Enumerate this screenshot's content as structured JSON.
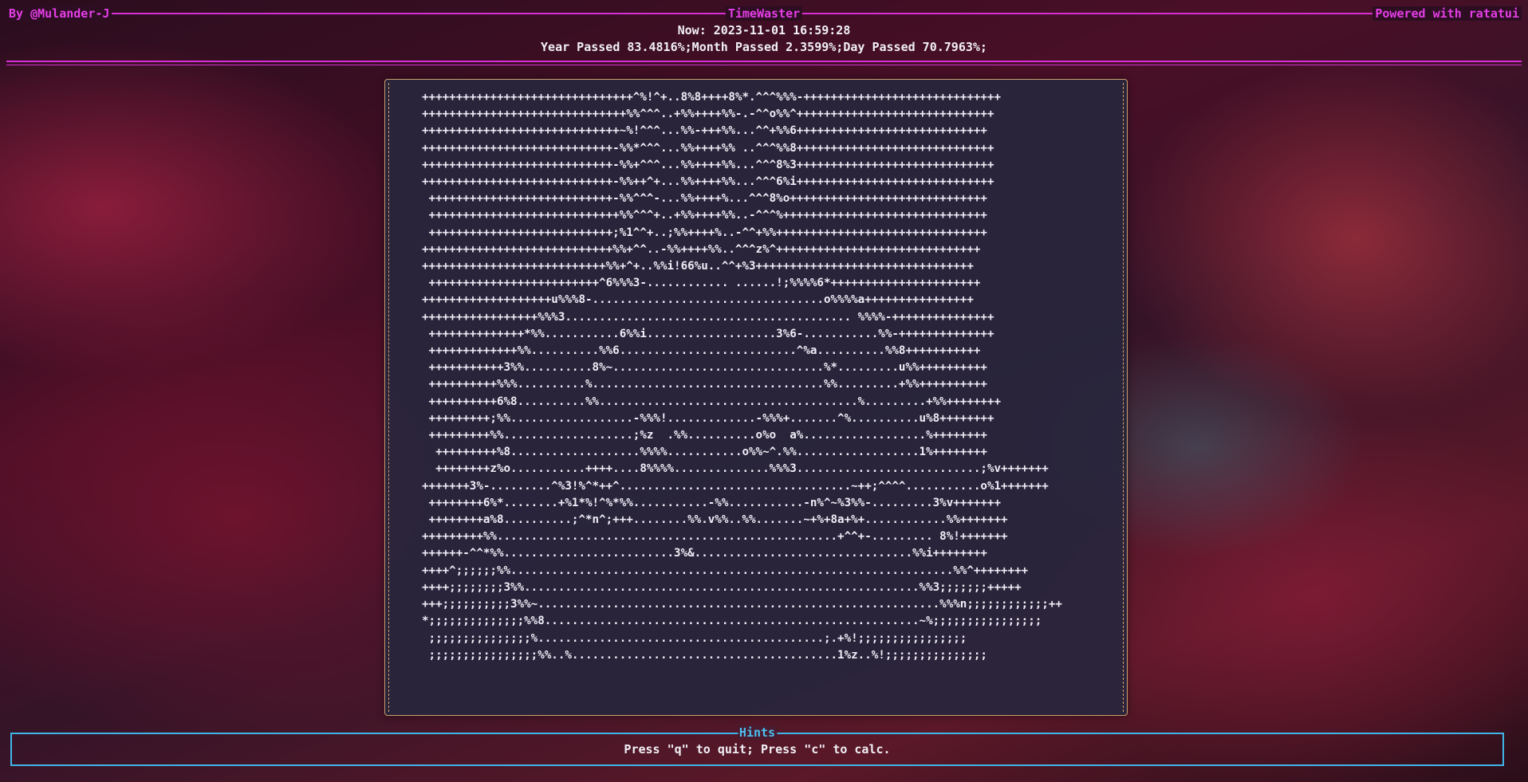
{
  "header": {
    "author": "By @Mulander-J",
    "title": "TimeWaster",
    "powered_by": "Powered with ratatui",
    "now_text": "Now: 2023-11-01 16:59:28",
    "passed_text": "Year Passed 83.4816%;Month Passed 2.3599%;Day Passed 70.7963%;",
    "border_color": "#d82ed8"
  },
  "art": {
    "lines": [
      "+++++++++++++++++++++++++++++++^%!^+..8%8++++8%*.^^^%%%-+++++++++++++++++++++++++++++",
      "++++++++++++++++++++++++++++++%%^^^..+%%++++%%-.-^^o%%^+++++++++++++++++++++++++++++",
      "+++++++++++++++++++++++++++++~%!^^^...%%-+++%%...^^+%%6++++++++++++++++++++++++++++",
      "++++++++++++++++++++++++++++-%%*^^^...%%++++%% ..^^^%%8+++++++++++++++++++++++++++++",
      "++++++++++++++++++++++++++++-%%+^^^...%%++++%%...^^^8%3+++++++++++++++++++++++++++++",
      "++++++++++++++++++++++++++++-%%++^+...%%++++%%...^^^6%i+++++++++++++++++++++++++++++",
      " +++++++++++++++++++++++++++-%%^^^-...%%++++%...^^^8%o+++++++++++++++++++++++++++++",
      " ++++++++++++++++++++++++++++%%^^^+..+%%++++%%..-^^^%++++++++++++++++++++++++++++++",
      " +++++++++++++++++++++++++++;%1^^+..;%%++++%..-^^+%%+++++++++++++++++++++++++++++++",
      "++++++++++++++++++++++++++++%%+^^..-%%++++%%..^^^z%^++++++++++++++++++++++++++++++",
      "+++++++++++++++++++++++++++%%+^+..%%i!66%u..^^+%3++++++++++++++++++++++++++++++++",
      " +++++++++++++++++++++++++^6%%%3-............ ......!;%%%%6*++++++++++++++++++++++",
      "+++++++++++++++++++u%%%8-..................................o%%%%a++++++++++++++++",
      "+++++++++++++++++%%%3.......................................... %%%%-+++++++++++++++",
      " ++++++++++++++*%%...........6%%i...................3%6-...........%%-++++++++++++++",
      " +++++++++++++%%..........%%6..........................^%a..........%%8+++++++++++",
      " +++++++++++3%%..........8%~...............................%*.........u%%++++++++++",
      " ++++++++++%%%..........%..................................%%.........+%%++++++++++",
      " ++++++++++6%8..........%%......................................%.........+%%++++++++",
      " +++++++++;%%..................-%%%!.............-%%%+.......^%..........u%8++++++++",
      " +++++++++%%...................;%z  .%%..........o%o  a%..................%++++++++",
      "  +++++++++%8...................%%%%...........o%%~^.%%..................1%++++++++",
      "  ++++++++z%o...........++++....8%%%%..............%%%3...........................;%v+++++++",
      "+++++++3%-.........^%3!%^*++^..................................~++;^^^^...........o%1+++++++",
      " ++++++++6%*........+%1*%!^%*%%...........-%%...........-n%^~%3%%-.........3%v+++++++",
      " ++++++++a%8..........;^*n^;+++........%%.v%%..%%.......~+%+8a+%+............%%+++++++",
      "+++++++++%%..................................................+^^+-......... 8%!+++++++",
      "++++++-^^*%%.........................3%&................................%%i++++++++",
      "++++^;;;;;;%%.................................................................%%^++++++++",
      "++++;;;;;;;;3%%..........................................................%%3;;;;;;;+++++",
      "+++;;;;;;;;;;3%%~...........................................................%%%n;;;;;;;;;;;;++",
      "*;;;;;;;;;;;;;;%%8.......................................................~%;;;;;;;;;;;;;;;;",
      " ;;;;;;;;;;;;;;;%..........................................;.+%!;;;;;;;;;;;;;;;;",
      " ;;;;;;;;;;;;;;;;%%..%.......................................1%z..%!;;;;;;;;;;;;;;;"
    ],
    "border_color": "#caa070"
  },
  "hints": {
    "title": "Hints",
    "text": "Press \"q\" to quit; Press \"c\" to calc.",
    "border_color": "#3fb6e8"
  }
}
